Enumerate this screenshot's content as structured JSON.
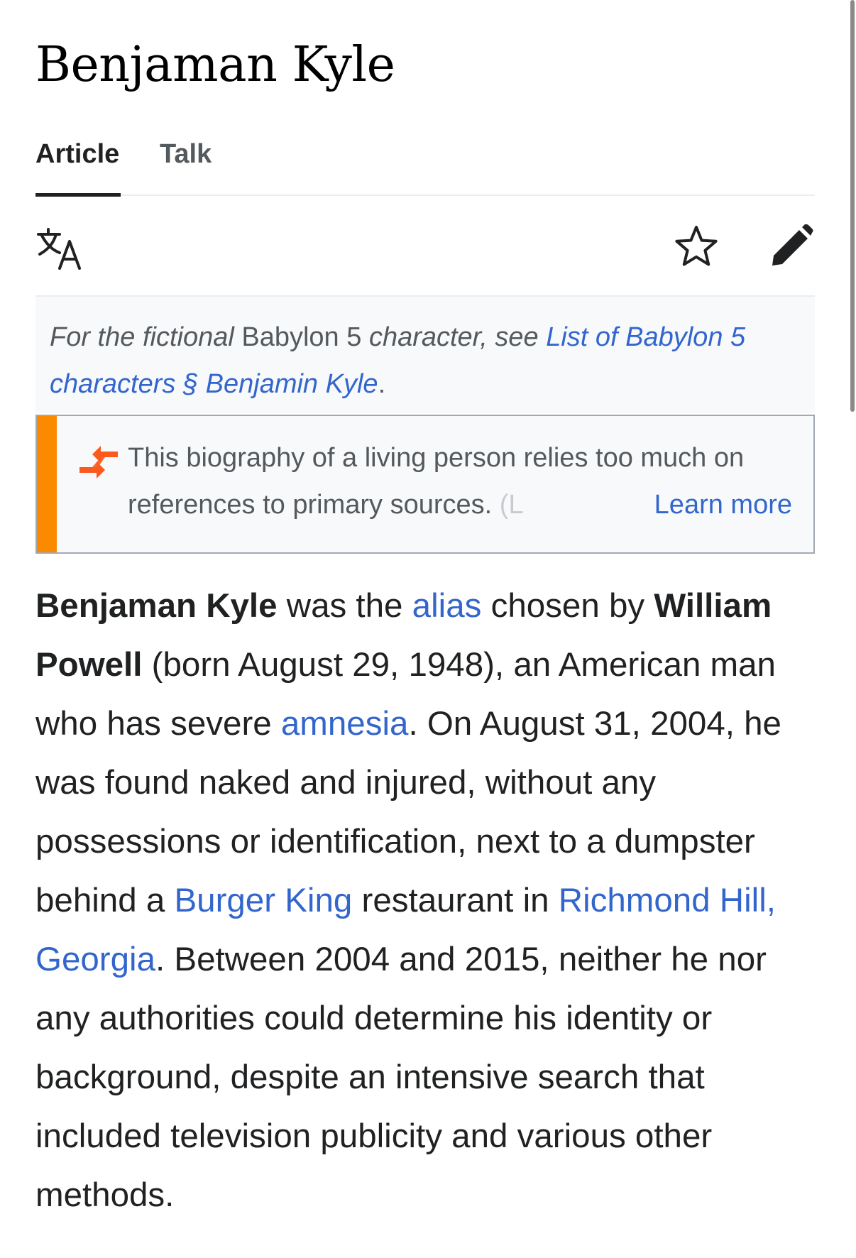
{
  "page": {
    "title": "Benjaman Kyle"
  },
  "tabs": [
    {
      "label": "Article",
      "active": true
    },
    {
      "label": "Talk",
      "active": false
    }
  ],
  "actions": {
    "language_icon": "translate-icon",
    "watch_icon": "star-icon",
    "edit_icon": "pencil-icon"
  },
  "hatnote": {
    "prefix_italic": "For the fictional",
    "plain": "Babylon 5",
    "middle_italic": "character, see",
    "link": "List of Babylon 5 characters § Benjamin Kyle",
    "suffix": "."
  },
  "notice": {
    "icon": "arrows-merge-icon",
    "accent_color": "#fc8a00",
    "text": "This biography of a living person relies too much on references to primary sources.",
    "faded": "(L",
    "learn_more": "Learn more"
  },
  "intro": {
    "s1_bold": "Benjaman Kyle",
    "s1_text": "was the",
    "s1_link": "alias",
    "s2_text": "chosen by",
    "s2_bold": "William Powell",
    "s3_text": "(born August 29, 1948), an American man who has severe",
    "s3_link": "amnesia",
    "s4_text": ". On August 31, 2004, he was found naked and injured, without any possessions or identification, next to a dumpster behind a",
    "s4_link": "Burger King",
    "s5_text": "restaurant in",
    "s5_link": "Richmond Hill, Georgia",
    "s6_text": ". Between 2004 and 2015, neither he nor any authorities could determine his identity or background, despite an intensive search that included television publicity and various other methods."
  },
  "colors": {
    "link": "#3366cc",
    "text": "#202122",
    "muted": "#54595d"
  }
}
